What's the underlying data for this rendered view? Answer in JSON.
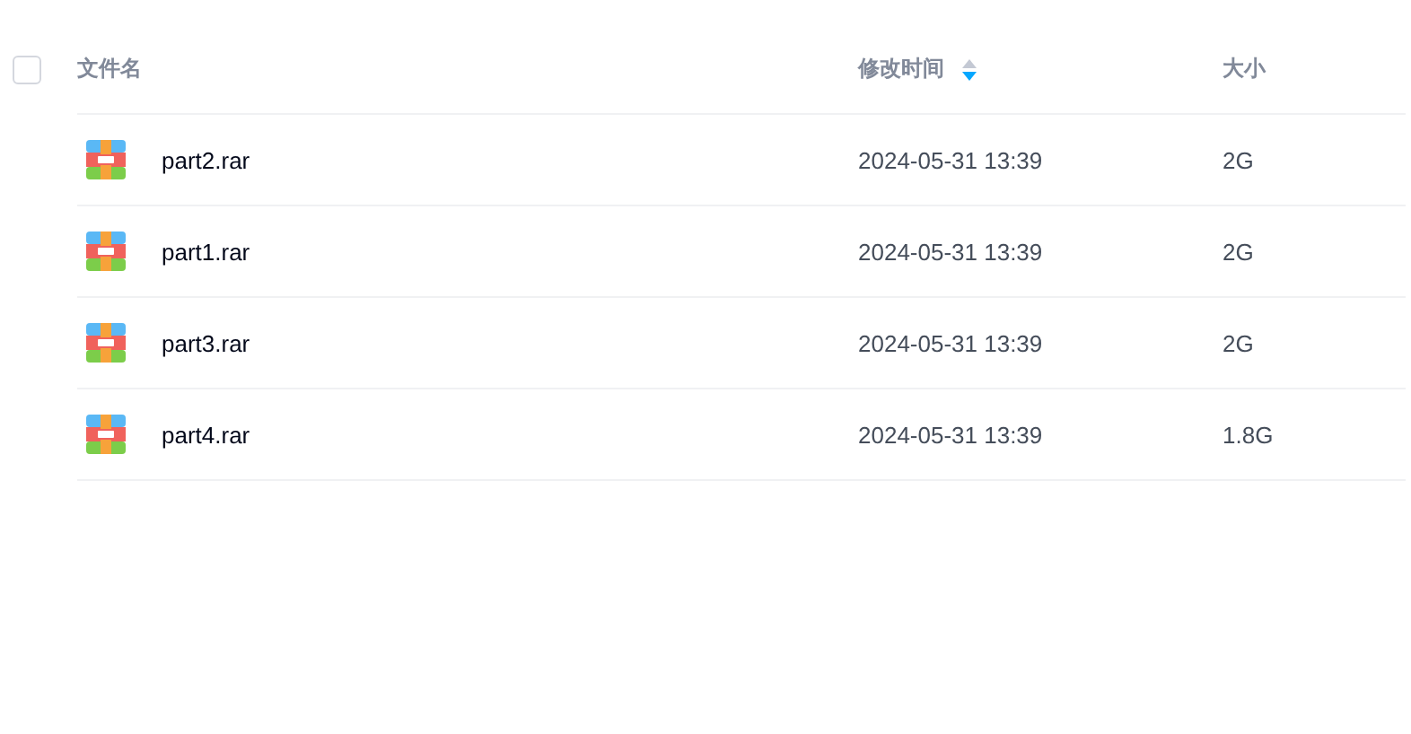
{
  "table": {
    "select_all": {
      "checked": false
    },
    "columns": [
      {
        "label": "文件名"
      },
      {
        "label": "修改时间",
        "sort_descending": true
      },
      {
        "label": "大小"
      }
    ],
    "rows": [
      {
        "name": "part2.rar",
        "modified": "2024-05-31 13:39",
        "size": "2G"
      },
      {
        "name": "part1.rar",
        "modified": "2024-05-31 13:39",
        "size": "2G"
      },
      {
        "name": "part3.rar",
        "modified": "2024-05-31 13:39",
        "size": "2G"
      },
      {
        "name": "part4.rar",
        "modified": "2024-05-31 13:39",
        "size": "1.8G"
      }
    ]
  }
}
